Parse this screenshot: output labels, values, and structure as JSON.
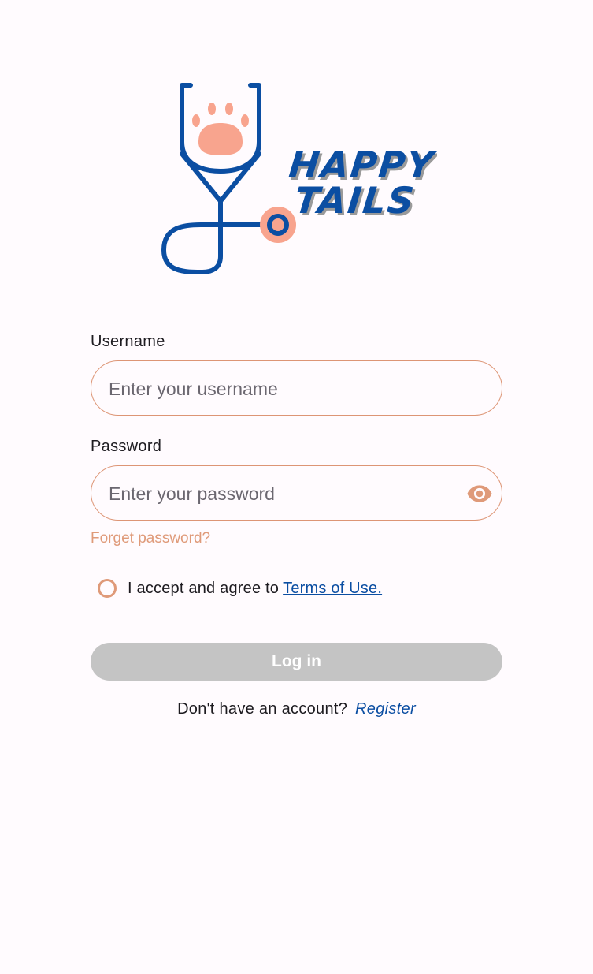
{
  "brand": {
    "name_line1": "HAPPY",
    "name_line2": "TAILS"
  },
  "colors": {
    "accent": "#df9a79",
    "brand_blue": "#0b4ea2",
    "disabled_button": "#c4c4c4",
    "background": "#fffbfe"
  },
  "form": {
    "username": {
      "label": "Username",
      "placeholder": "Enter your username",
      "value": ""
    },
    "password": {
      "label": "Password",
      "placeholder": "Enter your password",
      "value": "",
      "toggle_icon": "eye-icon"
    },
    "forgot_password": "Forget password?",
    "terms": {
      "text": "I accept and agree to",
      "link": "Terms of Use.",
      "checked": false
    },
    "login_label": "Log in",
    "register_prompt": "Don't have an account?",
    "register_link": "Register"
  }
}
